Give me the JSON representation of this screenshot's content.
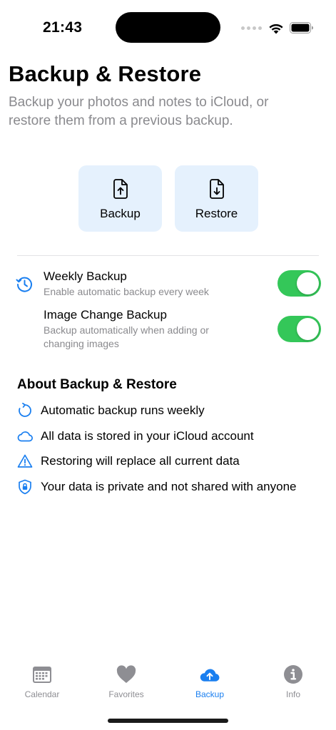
{
  "status_bar": {
    "time": "21:43",
    "icons": [
      "signal-dots-icon",
      "wifi-icon",
      "battery-icon"
    ]
  },
  "header": {
    "title": "Backup & Restore",
    "subtitle": "Backup your photos and notes to iCloud, or restore them from a previous backup."
  },
  "actions": {
    "backup": {
      "label": "Backup",
      "icon": "document-upload-icon"
    },
    "restore": {
      "label": "Restore",
      "icon": "document-download-icon"
    }
  },
  "settings": {
    "icon": "clock-history-icon",
    "weekly": {
      "title": "Weekly Backup",
      "description": "Enable automatic backup every week",
      "enabled": true
    },
    "image_change": {
      "title": "Image Change Backup",
      "description": "Backup automatically when adding or changing images",
      "enabled": true
    }
  },
  "about": {
    "heading": "About Backup & Restore",
    "items": [
      {
        "icon": "refresh-icon",
        "text": "Automatic backup runs weekly"
      },
      {
        "icon": "cloud-icon",
        "text": "All data is stored in your iCloud account"
      },
      {
        "icon": "warning-triangle-icon",
        "text": "Restoring will replace all current data"
      },
      {
        "icon": "lock-shield-icon",
        "text": "Your data is private and not shared with anyone"
      }
    ]
  },
  "tab_bar": {
    "active": "Backup",
    "tabs": [
      {
        "label": "Calendar",
        "icon": "calendar-icon"
      },
      {
        "label": "Favorites",
        "icon": "heart-icon"
      },
      {
        "label": "Backup",
        "icon": "cloud-upload-icon"
      },
      {
        "label": "Info",
        "icon": "info-icon"
      }
    ]
  },
  "colors": {
    "accent": "#1a7ff0",
    "card_background": "#e5f1fd",
    "toggle_on": "#34c759",
    "secondary_text": "#8a8a8e",
    "inactive_tab": "#8e8e93"
  }
}
